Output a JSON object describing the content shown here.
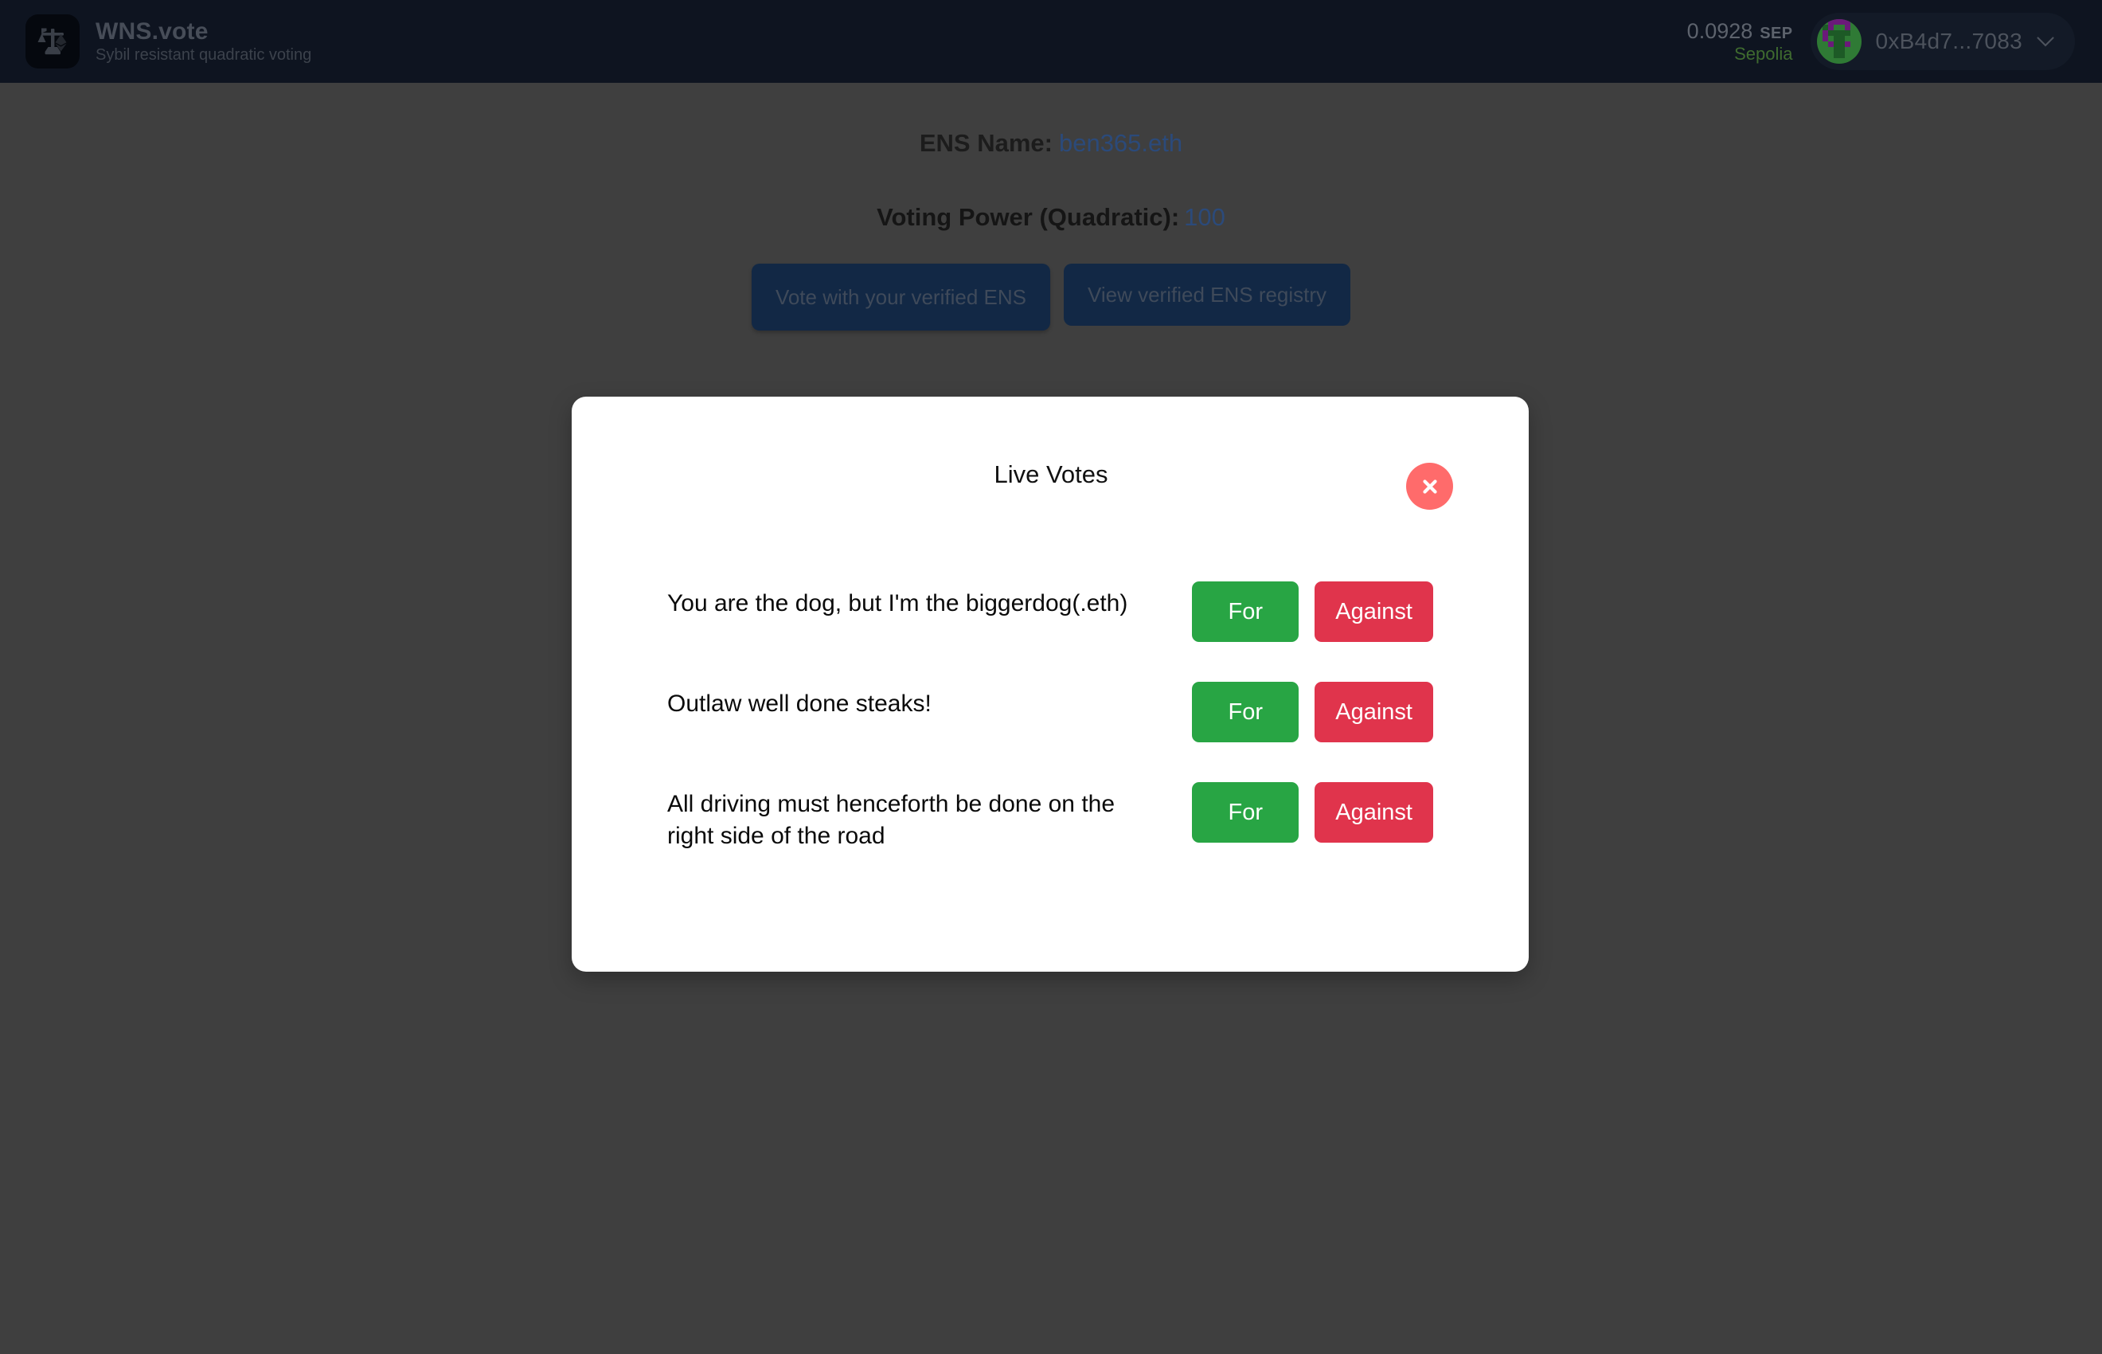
{
  "header": {
    "brand_title": "WNS.vote",
    "brand_tagline": "Sybil resistant quadratic voting",
    "logo_icon": "scale-ethereum-icon",
    "wallet": {
      "balance_amount": "0.0928",
      "balance_symbol": "SEP",
      "network": "Sepolia",
      "network_color": "#3f6b2f",
      "address": "0xB4d7...7083",
      "avatar_icon": "blockie-avatar",
      "chevron_icon": "chevron-down-icon"
    }
  },
  "main": {
    "ens_label": "ENS Name:",
    "ens_value": "ben365.eth",
    "voting_power_label": "Voting Power (Quadratic):",
    "voting_power_value": "100",
    "value_color": "#2b4a7a",
    "buttons": [
      {
        "label": "Vote with your verified ENS",
        "name": "vote-with-ens-button"
      },
      {
        "label": "View verified ENS registry",
        "name": "view-ens-registry-button"
      }
    ]
  },
  "modal": {
    "title": "Live Votes",
    "close_label": "×",
    "close_icon": "close-icon",
    "close_color": "#ff6b6b",
    "for_label": "For",
    "against_label": "Against",
    "for_color": "#28a544",
    "against_color": "#e0344c",
    "proposals": [
      {
        "text": "You are the dog, but I'm the biggerdog(.eth)"
      },
      {
        "text": "Outlaw well done steaks!"
      },
      {
        "text": "All driving must henceforth be done on the right side of the road"
      }
    ]
  }
}
